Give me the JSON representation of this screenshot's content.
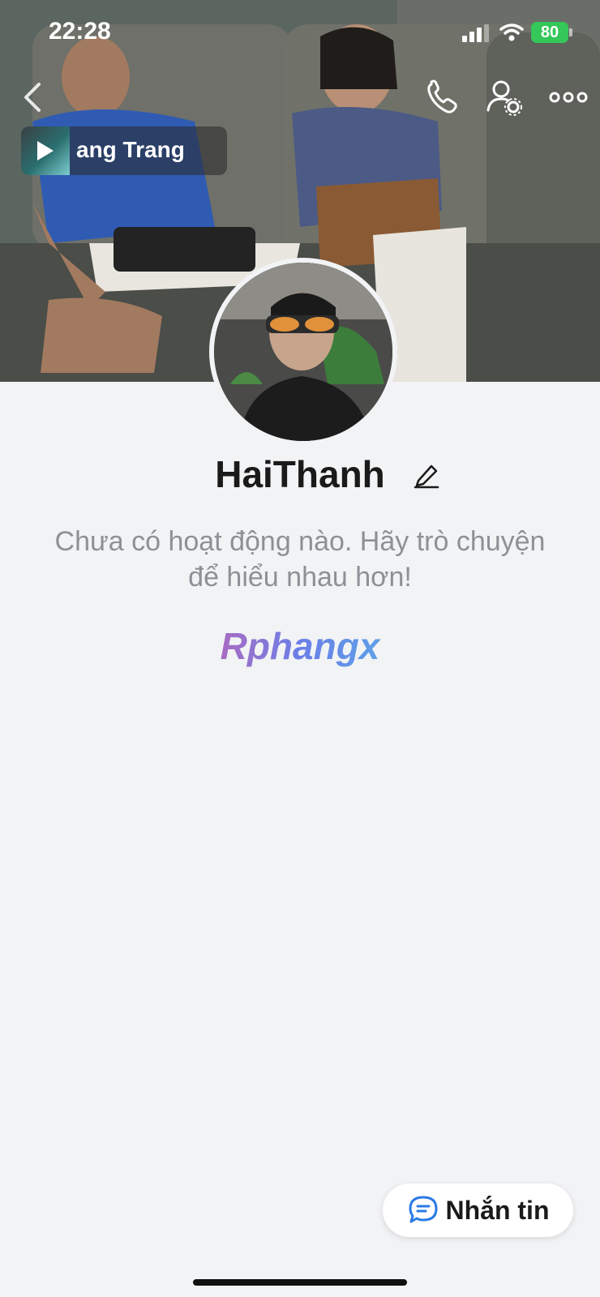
{
  "status_bar": {
    "time": "22:28",
    "battery": "80"
  },
  "header": {
    "back_icon": "chevron-left-icon",
    "call_icon": "phone-icon",
    "settings_icon": "user-settings-icon",
    "more_icon": "more-dots-icon"
  },
  "music": {
    "title": "ang Trang",
    "icon": "play-icon"
  },
  "profile": {
    "name": "HaiThanh",
    "edit_icon": "pencil-icon"
  },
  "empty_state": {
    "line1": "Chưa có hoạt động nào. Hãy trò chuyện",
    "line2": "để hiểu nhau hơn!"
  },
  "watermark": "Rphangx",
  "message_button": {
    "label": "Nhắn tin",
    "icon": "chat-bubble-icon"
  },
  "colors": {
    "background": "#f2f3f5",
    "accent": "#2a7be4",
    "battery": "#34c759"
  }
}
